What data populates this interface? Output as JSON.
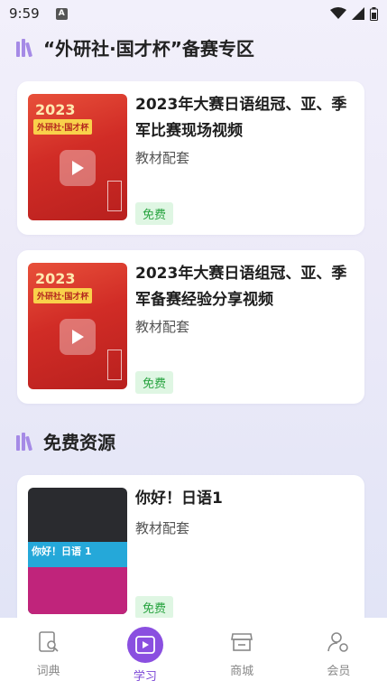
{
  "status_bar": {
    "time": "9:59",
    "badge": "A"
  },
  "sections": {
    "contest": {
      "title": "“外研社·国才杯”备赛专区"
    },
    "free": {
      "title": "免费资源"
    }
  },
  "cards": [
    {
      "cover": {
        "year": "2023",
        "banner": "外研社·国才杯"
      },
      "title": "2023年大赛日语组冠、亚、季军比赛现场视频",
      "subtitle": "教材配套",
      "badge": "免费"
    },
    {
      "cover": {
        "year": "2023",
        "banner": "外研社·国才杯"
      },
      "title": "2023年大赛日语组冠、亚、季军备赛经验分享视频",
      "subtitle": "教材配套",
      "badge": "免费"
    },
    {
      "cover": {
        "title": "你好！日语 1"
      },
      "title": "你好！日语1",
      "subtitle": "教材配套",
      "badge": "免费"
    }
  ],
  "nav": [
    {
      "label": "词典",
      "icon": "dictionary-icon"
    },
    {
      "label": "学习",
      "icon": "play-icon",
      "active": true
    },
    {
      "label": "商城",
      "icon": "store-icon"
    },
    {
      "label": "会员",
      "icon": "member-icon"
    }
  ],
  "colors": {
    "accent": "#8a4fe0",
    "free_badge_bg": "#dff6e3",
    "free_badge_text": "#27a33f"
  }
}
